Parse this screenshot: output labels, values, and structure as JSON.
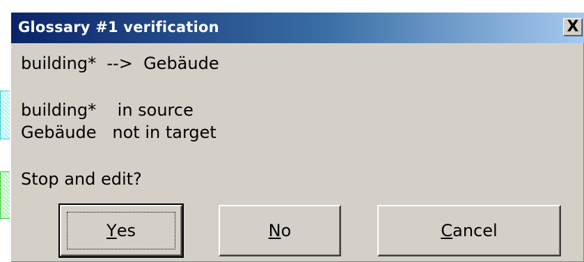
{
  "dialog": {
    "title": "Glossary #1 verification",
    "close_label": "X"
  },
  "message": {
    "mapping_line": "building*  -->  Gebäude",
    "source_line": "building*    in source",
    "target_line": "Gebäude   not in target",
    "question": "Stop and edit?"
  },
  "buttons": {
    "yes": {
      "accel": "Y",
      "rest": "es"
    },
    "no": {
      "accel": "N",
      "rest": "o"
    },
    "cancel": {
      "accel": "C",
      "rest": "ancel"
    }
  },
  "colors": {
    "dialog_face": "#d4d0c8",
    "title_gradient_start": "#0a246a",
    "title_gradient_end": "#a6caf0",
    "title_text": "#ffffff"
  }
}
